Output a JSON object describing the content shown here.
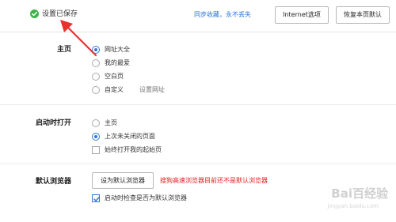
{
  "header": {
    "saved_status": "设置已保存",
    "sync_link": "同步收藏，永不丢失",
    "internet_options_button": "Internet选项",
    "restore_defaults_button": "恢复本页默认"
  },
  "homepage": {
    "label": "主页",
    "options": [
      {
        "label": "网址大全",
        "selected": true
      },
      {
        "label": "我的最爱",
        "selected": false
      },
      {
        "label": "空白页",
        "selected": false
      },
      {
        "label": "自定义",
        "selected": false
      }
    ],
    "set_url_link": "设置网址"
  },
  "startup": {
    "label": "启动时打开",
    "options": [
      {
        "label": "主页",
        "selected": false
      },
      {
        "label": "上次未关闭的页面",
        "selected": true
      }
    ],
    "always_open_checkbox": {
      "label": "始终打开我的起始页",
      "checked": false
    }
  },
  "default_browser": {
    "label": "默认浏览器",
    "button": "设为默认浏览器",
    "warning": "搜狗高速浏览器目前还不是默认浏览器",
    "check_on_startup": {
      "label": "启动时检查是否为默认浏览器",
      "checked": true
    }
  },
  "watermark": {
    "text": "Bai百经验",
    "url": "jingyan.baidu.com"
  },
  "colors": {
    "accent": "#2f7ad6",
    "success": "#3cb34a",
    "warning": "#e02020",
    "link": "#2a74d8",
    "annotation_arrow": "#e8322f"
  },
  "icons": [
    "check-circle-icon",
    "annotation-arrow"
  ]
}
